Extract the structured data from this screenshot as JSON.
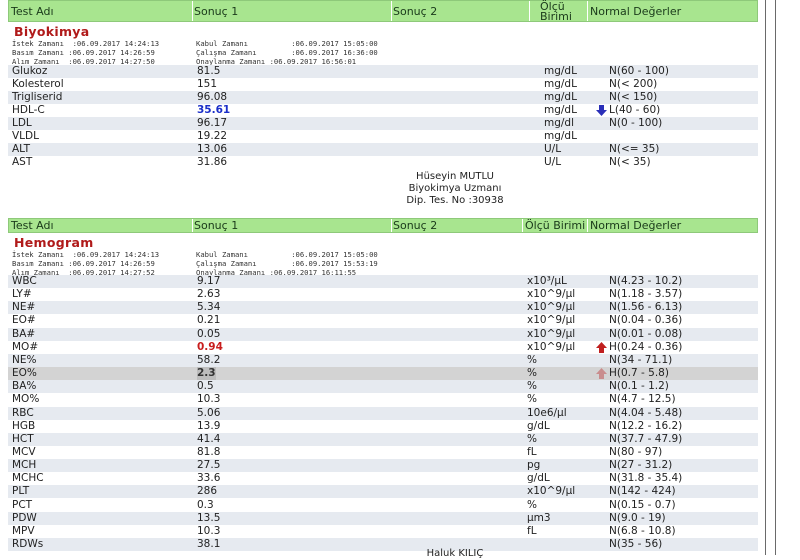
{
  "headers": {
    "test": "Test Adı",
    "result": "Sonuç 1",
    "result2": "Sonuç 2",
    "unit_top": "Ölçü",
    "unit_bottom": "Birimi",
    "unit_single": "Ölçü Birimi",
    "normal": "Normal Değerler"
  },
  "biyokimya": {
    "title": "Biyokimya",
    "meta_left": "İstek Zamanı  :06.09.2017 14:24:13\nBasım Zamanı :06.09.2017 14:26:59\nAlım Zamanı  :06.09.2017 14:27:50",
    "meta_right": "Kabul Zamanı          :06.09.2017 15:05:00\nÇalışma Zamanı        :06.09.2017 16:36:00\nOnaylanma Zamanı :06.09.2017 16:56:01",
    "rows": [
      {
        "test": "Glukoz",
        "result": "81.5",
        "unit": "mg/dL",
        "normal": "N(60 - 100)"
      },
      {
        "test": "Kolesterol",
        "result": "151",
        "unit": "mg/dL",
        "normal": "N(< 200)"
      },
      {
        "test": "Trigliserid",
        "result": "96.08",
        "unit": "mg/dL",
        "normal": "N(< 150)"
      },
      {
        "test": "HDL-C",
        "result": "35.61",
        "unit": "mg/dL",
        "normal": "L(40 - 60)",
        "flag": "low"
      },
      {
        "test": "LDL",
        "result": "96.17",
        "unit": "mg/dl",
        "normal": "N(0 - 100)"
      },
      {
        "test": "VLDL",
        "result": "19.22",
        "unit": "mg/dL",
        "normal": ""
      },
      {
        "test": "ALT",
        "result": "13.06",
        "unit": "U/L",
        "normal": "N(<= 35)"
      },
      {
        "test": "AST",
        "result": "31.86",
        "unit": "U/L",
        "normal": "N(< 35)"
      }
    ],
    "signature": {
      "name": "Hüseyin MUTLU",
      "role": "Biyokimya Uzmanı",
      "dip": "Dip. Tes. No :30938"
    }
  },
  "hemogram": {
    "title": "Hemogram",
    "meta_left": "İstek Zamanı  :06.09.2017 14:24:13\nBasım Zamanı :06.09.2017 14:26:59\nAlım Zamanı  :06.09.2017 14:27:52",
    "meta_right": "Kabul Zamanı          :06.09.2017 15:05:00\nÇalışma Zamanı        :06.09.2017 15:53:19\nOnaylanma Zamanı :06.09.2017 16:11:55",
    "rows": [
      {
        "test": "WBC",
        "result": "9.17",
        "unit": "x10³/µL",
        "normal": "N(4.23 - 10.2)"
      },
      {
        "test": "LY#",
        "result": "2.63",
        "unit": "x10^9/µl",
        "normal": "N(1.18 - 3.57)"
      },
      {
        "test": "NE#",
        "result": "5.34",
        "unit": "x10^9/µl",
        "normal": "N(1.56 - 6.13)"
      },
      {
        "test": "EO#",
        "result": "0.21",
        "unit": "x10^9/µl",
        "normal": "N(0.04 - 0.36)"
      },
      {
        "test": "BA#",
        "result": "0.05",
        "unit": "x10^9/µl",
        "normal": "N(0.01 - 0.08)"
      },
      {
        "test": "MO#",
        "result": "0.94",
        "unit": "x10^9/µl",
        "normal": "H(0.24 - 0.36)",
        "flag": "high"
      },
      {
        "test": "NE%",
        "result": "58.2",
        "unit": "%",
        "normal": "N(34 - 71.1)"
      },
      {
        "test": "EO%",
        "result": "2.3",
        "unit": "%",
        "normal": "H(0.7 - 5.8)",
        "flag": "high-sel"
      },
      {
        "test": "BA%",
        "result": "0.5",
        "unit": "%",
        "normal": "N(0.1 - 1.2)"
      },
      {
        "test": "MO%",
        "result": "10.3",
        "unit": "%",
        "normal": "N(4.7 - 12.5)"
      },
      {
        "test": "RBC",
        "result": "5.06",
        "unit": "10e6/µl",
        "normal": "N(4.04 - 5.48)"
      },
      {
        "test": "HGB",
        "result": "13.9",
        "unit": "g/dL",
        "normal": "N(12.2 - 16.2)"
      },
      {
        "test": "HCT",
        "result": "41.4",
        "unit": "%",
        "normal": "N(37.7 - 47.9)"
      },
      {
        "test": "MCV",
        "result": "81.8",
        "unit": "fL",
        "normal": "N(80 - 97)"
      },
      {
        "test": "MCH",
        "result": "27.5",
        "unit": "pg",
        "normal": "N(27 - 31.2)"
      },
      {
        "test": "MCHC",
        "result": "33.6",
        "unit": "g/dL",
        "normal": "N(31.8 - 35.4)"
      },
      {
        "test": "PLT",
        "result": "286",
        "unit": "x10^9/µl",
        "normal": "N(142 - 424)"
      },
      {
        "test": "PCT",
        "result": "0.3",
        "unit": "%",
        "normal": "N(0.15 - 0.7)"
      },
      {
        "test": "PDW",
        "result": "13.5",
        "unit": "µm3",
        "normal": "N(9.0 - 19)"
      },
      {
        "test": "MPV",
        "result": "10.3",
        "unit": "fL",
        "normal": "N(6.8 - 10.8)"
      },
      {
        "test": "RDWs",
        "result": "38.1",
        "unit": "",
        "normal": "N(35 - 56)"
      }
    ],
    "signature": {
      "name": "Haluk KILIÇ"
    }
  }
}
